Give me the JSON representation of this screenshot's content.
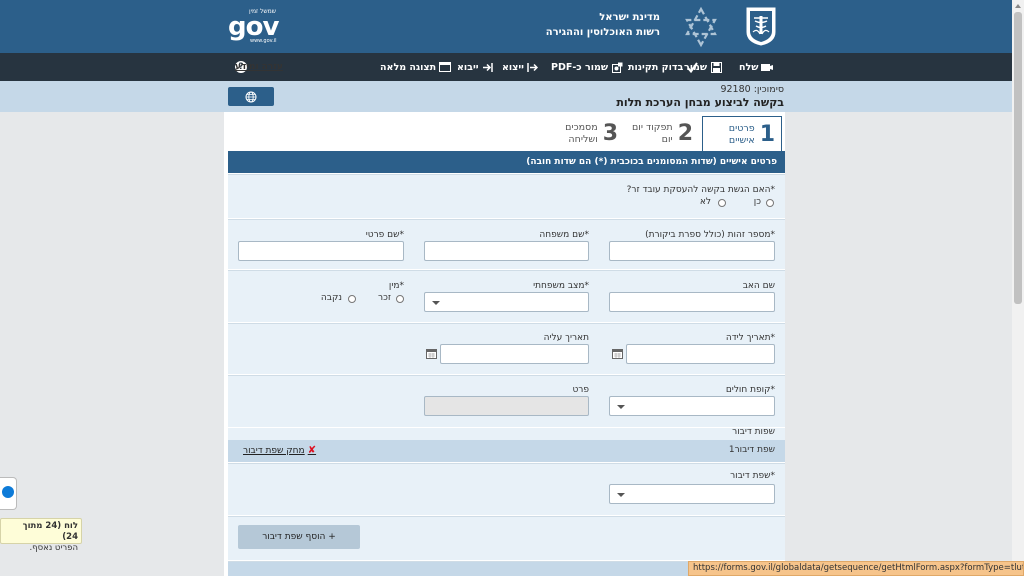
{
  "header": {
    "gov_small": "שמשל זמין",
    "gov_big": "gov",
    "gov_url": "www.gov.il",
    "org_line1": "מדינת ישראל",
    "org_line2": "רשות האוכלוסין וההגירה",
    "bg_color": "#2c5f8a"
  },
  "toolbar": {
    "send": "שלח",
    "save": "שמור",
    "check": "בדוק תקינות",
    "save_pdf": "שמור כ-PDF",
    "export": "ייצוא",
    "import": "ייבוא",
    "fullview": "תצוגה מלאה",
    "help": "עזרה ומידע"
  },
  "title": {
    "ref": "סימוכין: 92180",
    "form_title": "בקשה לביצוע מבחן הערכת תלות"
  },
  "steps": [
    {
      "num": "1",
      "label": "פרטים אישיים"
    },
    {
      "num": "2",
      "label": "תפקוד יום יום"
    },
    {
      "num": "3",
      "label": "מסמכים ושליחה"
    }
  ],
  "section": {
    "header": "פרטים אישיים (שדות המסומנים בכוכבית (*) הם שדות חובה)"
  },
  "form": {
    "foreign_worker_q": "*האם הגשת בקשה להעסקת עובד זר?",
    "opt_yes": "כן",
    "opt_no": "לא",
    "id_label": "*מספר זהות (כולל ספרת ביקורת)",
    "last_name_label": "*שם משפחה",
    "first_name_label": "*שם פרטי",
    "father_name_label": "שם האב",
    "marital_label": "*מצב משפחתי",
    "gender_label": "*מין",
    "opt_male": "זכר",
    "opt_female": "נקבה",
    "birth_label": "*תאריך לידה",
    "aliyah_label": "תאריך עליה",
    "hmo_label": "*קופת חולים",
    "detail_label": "פרט",
    "spoken_lang_title": "שפות דיבור",
    "spoken_lang_sub": "שפת דיבור1",
    "delete_lang": "מחק שפת דיבור",
    "spoken_lang_label": "*שפת דיבור",
    "add_lang": "+ הוסף שפת דיבור"
  },
  "tooltip": {
    "line1": "לוח (24 מתוך 24)",
    "line2": "הפריט נאסף."
  },
  "status_url": "https://forms.gov.il/globaldata/getsequence/getHtmlForm.aspx?formType=tlut@piba.gov.il#"
}
